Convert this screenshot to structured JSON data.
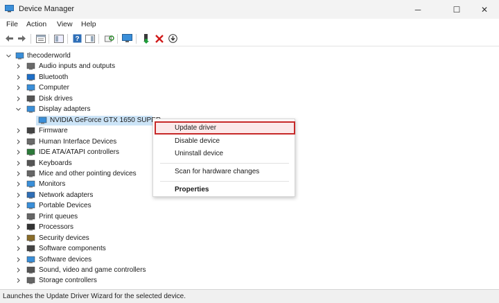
{
  "window": {
    "title": "Device Manager",
    "minimize_glyph": "─",
    "maximize_glyph": "☐",
    "close_glyph": "✕"
  },
  "menubar": {
    "items": [
      {
        "label": "File"
      },
      {
        "label": "Action"
      },
      {
        "label": "View"
      },
      {
        "label": "Help"
      }
    ]
  },
  "toolbar": {
    "buttons": [
      {
        "name": "back-icon"
      },
      {
        "name": "forward-icon"
      },
      {
        "name": "properties-icon"
      },
      {
        "name": "show-hide-console-tree-icon"
      },
      {
        "name": "help-icon"
      },
      {
        "name": "action-pane-icon"
      },
      {
        "name": "scan-hardware-icon"
      },
      {
        "name": "update-driver-icon"
      },
      {
        "name": "uninstall-icon"
      },
      {
        "name": "download-icon"
      }
    ]
  },
  "tree": {
    "root": {
      "label": "thecoderworld",
      "expanded": true
    },
    "items": [
      {
        "label": "Audio inputs and outputs",
        "icon": "speaker-icon",
        "expanded": false
      },
      {
        "label": "Bluetooth",
        "icon": "bluetooth-icon",
        "expanded": false
      },
      {
        "label": "Computer",
        "icon": "computer-icon",
        "expanded": false
      },
      {
        "label": "Disk drives",
        "icon": "disk-drive-icon",
        "expanded": false
      },
      {
        "label": "Display adapters",
        "icon": "display-adapter-icon",
        "expanded": true,
        "children": [
          {
            "label": "NVIDIA GeForce GTX 1650 SUPER",
            "icon": "display-adapter-icon",
            "selected": true
          }
        ]
      },
      {
        "label": "Firmware",
        "icon": "firmware-icon",
        "expanded": false
      },
      {
        "label": "Human Interface Devices",
        "icon": "hid-icon",
        "expanded": false
      },
      {
        "label": "IDE ATA/ATAPI controllers",
        "icon": "ide-controller-icon",
        "expanded": false
      },
      {
        "label": "Keyboards",
        "icon": "keyboard-icon",
        "expanded": false
      },
      {
        "label": "Mice and other pointing devices",
        "icon": "mouse-icon",
        "expanded": false
      },
      {
        "label": "Monitors",
        "icon": "monitor-icon",
        "expanded": false
      },
      {
        "label": "Network adapters",
        "icon": "network-adapter-icon",
        "expanded": false
      },
      {
        "label": "Portable Devices",
        "icon": "portable-device-icon",
        "expanded": false
      },
      {
        "label": "Print queues",
        "icon": "printer-icon",
        "expanded": false
      },
      {
        "label": "Processors",
        "icon": "processor-icon",
        "expanded": false
      },
      {
        "label": "Security devices",
        "icon": "security-device-icon",
        "expanded": false
      },
      {
        "label": "Software components",
        "icon": "software-component-icon",
        "expanded": false
      },
      {
        "label": "Software devices",
        "icon": "software-device-icon",
        "expanded": false
      },
      {
        "label": "Sound, video and game controllers",
        "icon": "sound-controller-icon",
        "expanded": false
      },
      {
        "label": "Storage controllers",
        "icon": "storage-controller-icon",
        "expanded": false
      }
    ]
  },
  "context_menu": {
    "items": [
      {
        "label": "Update driver",
        "highlighted": true
      },
      {
        "label": "Disable device"
      },
      {
        "label": "Uninstall device"
      },
      {
        "label": "Scan for hardware changes"
      },
      {
        "label": "Properties",
        "bold": true
      }
    ]
  },
  "status_bar": {
    "text": "Launches the Update Driver Wizard for the selected device."
  },
  "colors": {
    "selection": "#cce4f7",
    "highlight_border": "#c62828",
    "accent_blue": "#1e6fc8"
  }
}
